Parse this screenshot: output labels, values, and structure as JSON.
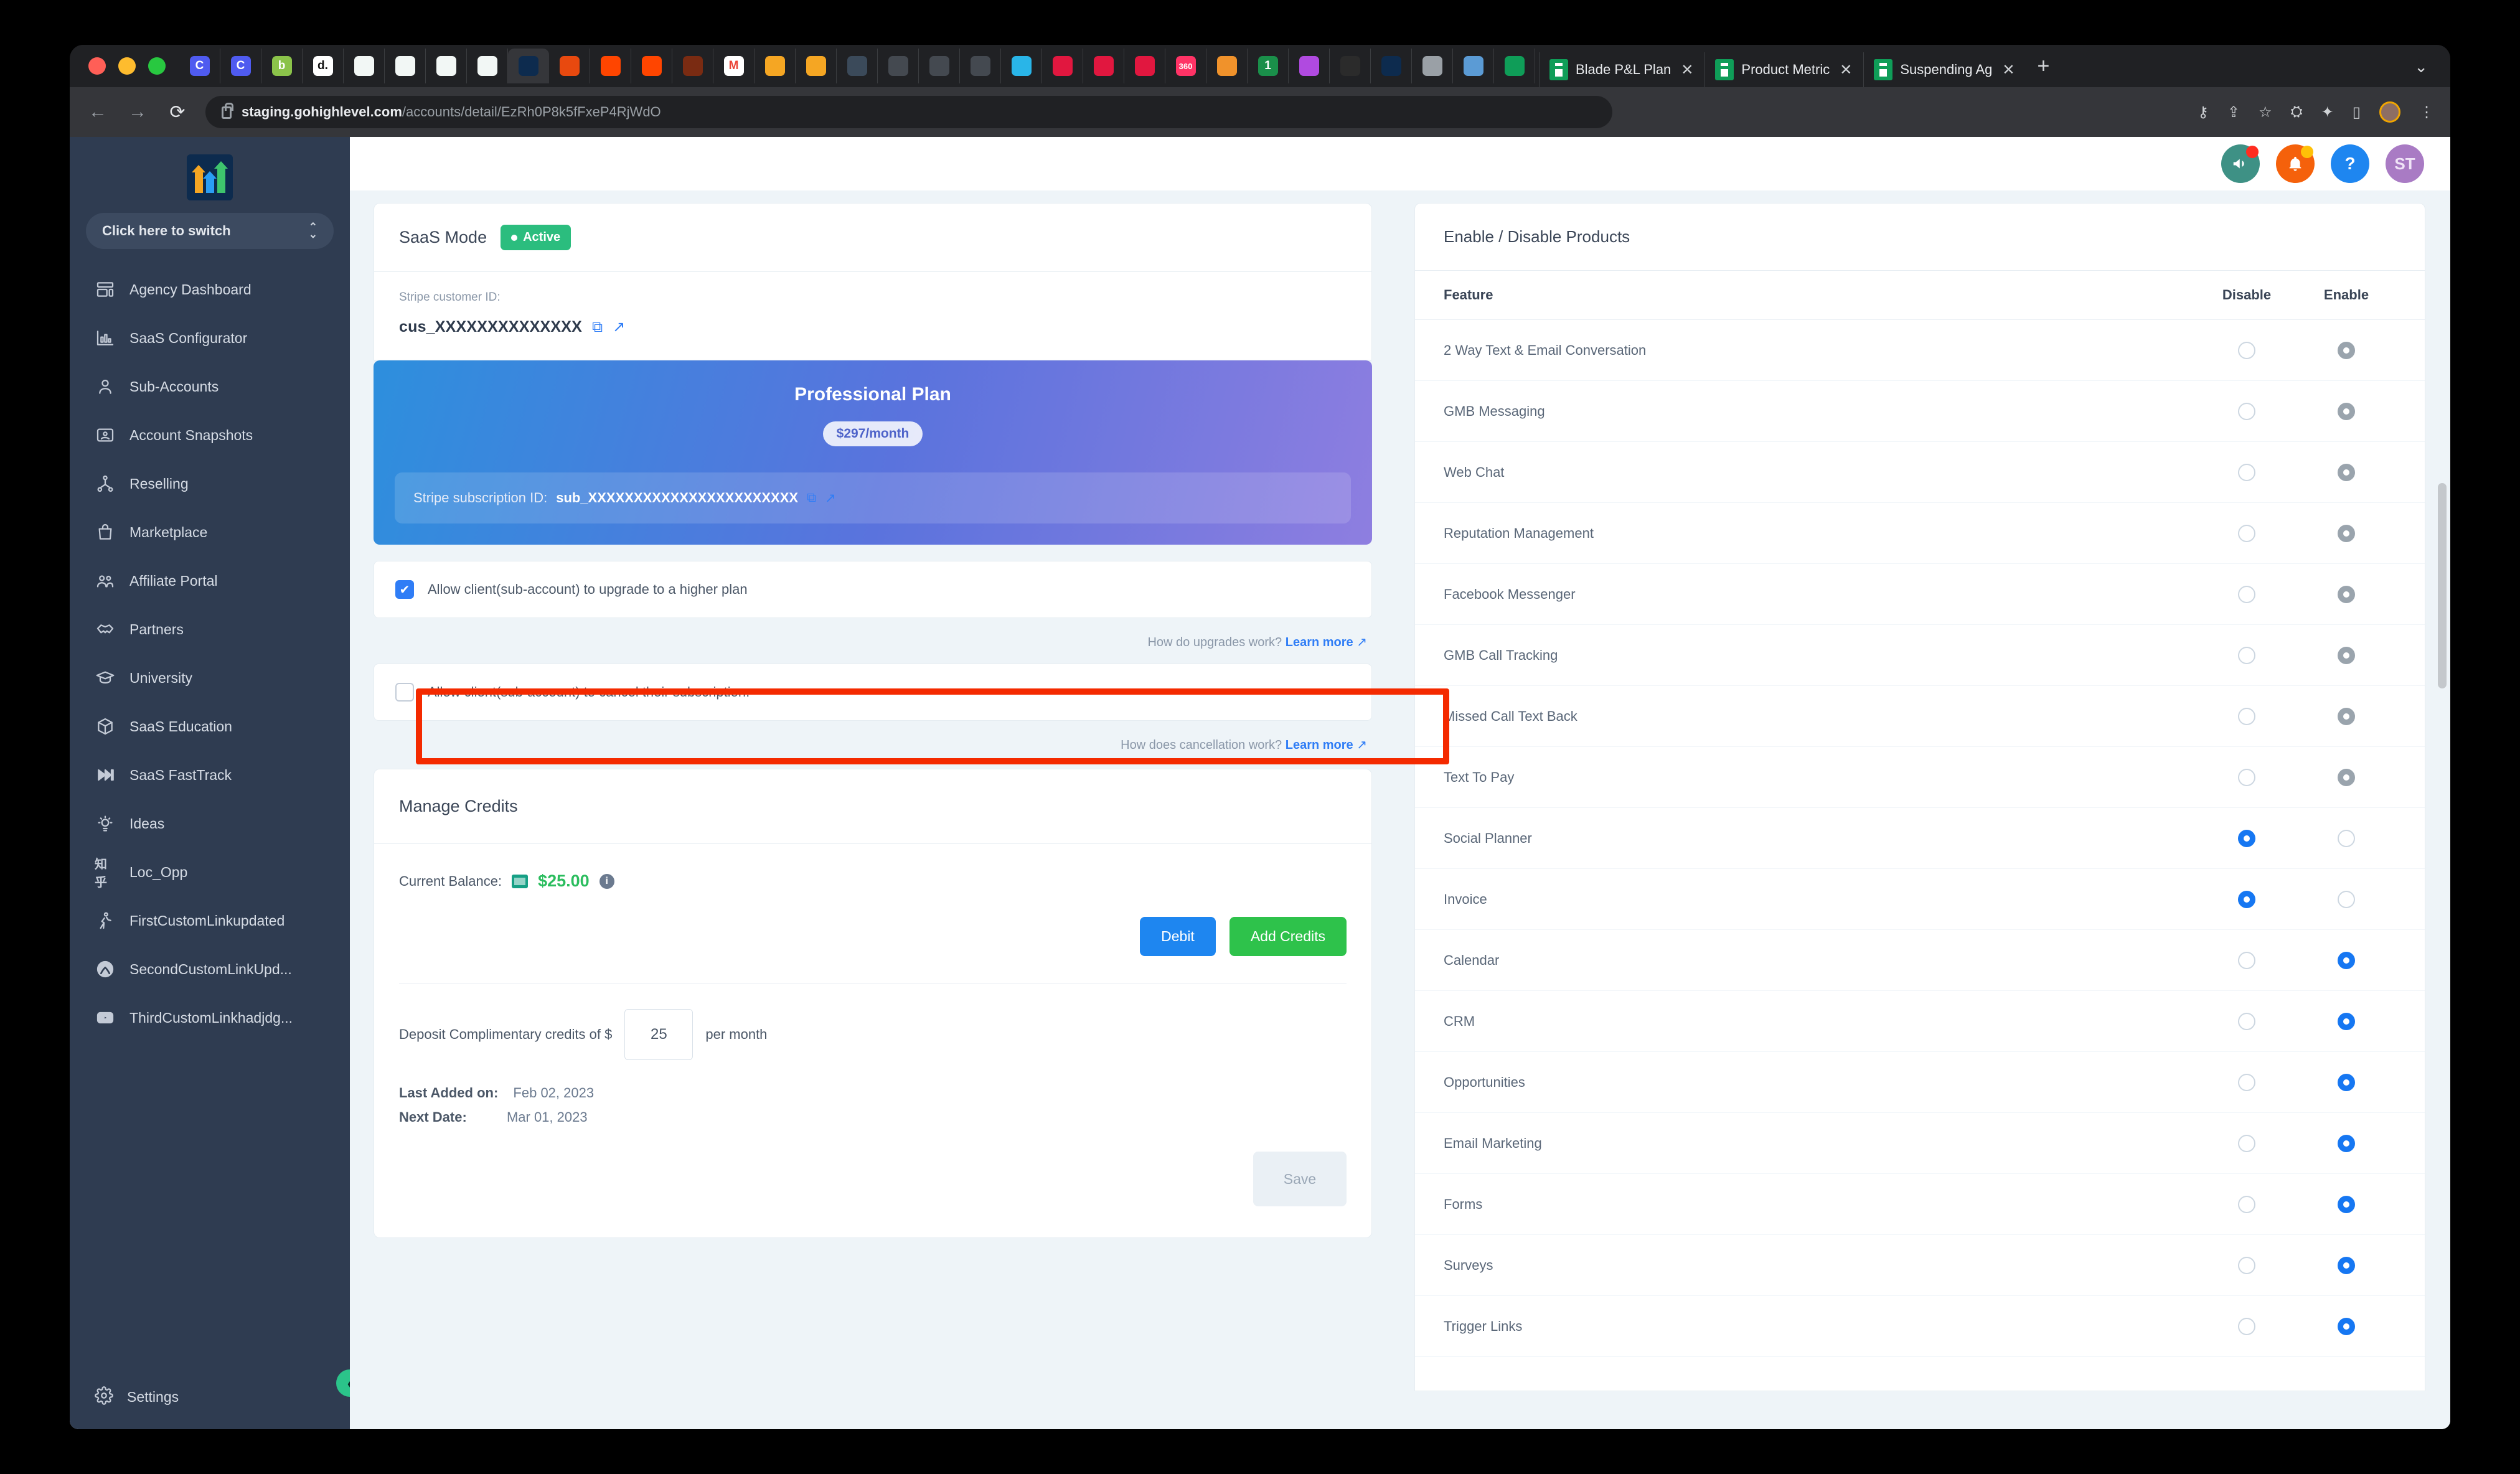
{
  "browser": {
    "traffic_lights": [
      "close",
      "minimize",
      "zoom"
    ],
    "pinned_tabs": [
      {
        "name": "c-tab-1",
        "glyph": "C",
        "bg": "#4f5bf0"
      },
      {
        "name": "c-tab-2",
        "glyph": "C",
        "bg": "#4f5bf0"
      },
      {
        "name": "b-tab",
        "glyph": "b",
        "bg": "#8bc34a"
      },
      {
        "name": "d-tab",
        "glyph": "d.",
        "bg": "#ffffff",
        "fg": "#111111"
      },
      {
        "name": "doc-tab-1",
        "glyph": "",
        "bg": "#f2f7f5"
      },
      {
        "name": "doc-tab-2",
        "glyph": "",
        "bg": "#f2f7f5"
      },
      {
        "name": "doc-tab-3",
        "glyph": "",
        "bg": "#f2f7f5"
      },
      {
        "name": "doc-tab-4",
        "glyph": "",
        "bg": "#f2f7f5"
      },
      {
        "name": "highlevel-tab",
        "glyph": "",
        "bg": "#0d2b4e",
        "active": true
      },
      {
        "name": "swirl-tab",
        "glyph": "",
        "bg": "#e8490f"
      },
      {
        "name": "orange-tab-1",
        "glyph": "",
        "bg": "#ff4500"
      },
      {
        "name": "orange-tab-2",
        "glyph": "",
        "bg": "#ff4500"
      },
      {
        "name": "brown-tab",
        "glyph": "",
        "bg": "#7a2b12"
      },
      {
        "name": "gmail-tab",
        "glyph": "M",
        "bg": "#ffffff",
        "fg": "#ea4335"
      },
      {
        "name": "fire-tab-1",
        "glyph": "",
        "bg": "#f5a623"
      },
      {
        "name": "fire-tab-2",
        "glyph": "",
        "bg": "#f5a623"
      },
      {
        "name": "person-tab",
        "glyph": "",
        "bg": "#3b4a5a"
      },
      {
        "name": "hex-tab-1",
        "glyph": "",
        "bg": "#444950"
      },
      {
        "name": "hex-tab-2",
        "glyph": "",
        "bg": "#444950"
      },
      {
        "name": "hex-tab-3",
        "glyph": "",
        "bg": "#444950"
      },
      {
        "name": "snowflake-tab",
        "glyph": "",
        "bg": "#29b5e8"
      },
      {
        "name": "red-circle-tab-1",
        "glyph": "",
        "bg": "#e1173f"
      },
      {
        "name": "red-circle-tab-2",
        "glyph": "",
        "bg": "#e1173f"
      },
      {
        "name": "target-tab",
        "glyph": "",
        "bg": "#e1173f"
      },
      {
        "name": "360-tab",
        "glyph": "360",
        "bg": "#ff3366"
      },
      {
        "name": "triangle-tab",
        "glyph": "",
        "bg": "#f0922b"
      },
      {
        "name": "one-tab",
        "glyph": "1",
        "bg": "#1a8f4a"
      },
      {
        "name": "wave-tab",
        "glyph": "",
        "bg": "#b04ae0"
      },
      {
        "name": "circle-logo-tab",
        "glyph": "",
        "bg": "#2b2b2b"
      },
      {
        "name": "highlevel-tab-2",
        "glyph": "",
        "bg": "#0d2b4e"
      },
      {
        "name": "apple-tab",
        "glyph": "",
        "bg": "#9aa0a6"
      },
      {
        "name": "chart-tab",
        "glyph": "",
        "bg": "#5b9bd5"
      },
      {
        "name": "drive-tab",
        "glyph": "",
        "bg": "#0f9d58"
      }
    ],
    "tabs": [
      {
        "title": "Blade P&L Plan",
        "icon": "sheets-icon"
      },
      {
        "title": "Product Metric",
        "icon": "sheets-icon"
      },
      {
        "title": "Suspending Ag",
        "icon": "sheets-icon"
      }
    ],
    "new_tab_label": "+",
    "tab_list_chevron": "⌄",
    "nav": {
      "back": "←",
      "forward": "→",
      "reload": "⟳"
    },
    "url_domain": "staging.gohighlevel.com",
    "url_path": "/accounts/detail/EzRh0P8k5fFxeP4RjWdO",
    "toolbar_icons": [
      "password-key-icon",
      "share-icon",
      "bookmark-star-icon",
      "camera-icon",
      "extension-puzzle-icon",
      "sidebar-panel-icon",
      "profile-avatar",
      "kebab-menu-icon"
    ]
  },
  "header": {
    "announce": {
      "name": "megaphone-icon",
      "bg": "#3e9185",
      "dot": "#ff2d20",
      "glyph": "📣"
    },
    "notifications": {
      "name": "bell-icon",
      "bg": "#f5610b",
      "dot": "#ffc107",
      "glyph": "🔔"
    },
    "help": {
      "name": "help-icon",
      "bg": "#1e86f0",
      "glyph": "?"
    },
    "avatar": {
      "name": "user-avatar",
      "bg": "#a97bc4",
      "initials": "ST"
    }
  },
  "sidebar": {
    "switcher_label": "Click here to switch",
    "items": [
      {
        "label": "Agency Dashboard",
        "icon": "dashboard-icon"
      },
      {
        "label": "SaaS Configurator",
        "icon": "bar-chart-icon"
      },
      {
        "label": "Sub-Accounts",
        "icon": "user-icon"
      },
      {
        "label": "Account Snapshots",
        "icon": "snapshot-icon"
      },
      {
        "label": "Reselling",
        "icon": "network-icon"
      },
      {
        "label": "Marketplace",
        "icon": "bag-icon"
      },
      {
        "label": "Affiliate Portal",
        "icon": "people-icon"
      },
      {
        "label": "Partners",
        "icon": "handshake-icon"
      },
      {
        "label": "University",
        "icon": "graduation-cap-icon"
      },
      {
        "label": "SaaS Education",
        "icon": "box-icon"
      },
      {
        "label": "SaaS FastTrack",
        "icon": "fast-forward-icon"
      },
      {
        "label": "Ideas",
        "icon": "lightbulb-icon"
      },
      {
        "label": "Loc_Opp",
        "icon": "zhihu-icon"
      },
      {
        "label": "FirstCustomLinkupdated",
        "icon": "walking-icon"
      },
      {
        "label": "SecondCustomLinkUpd...",
        "icon": "xbox-icon"
      },
      {
        "label": "ThirdCustomLinkhadjdg...",
        "icon": "youtube-icon"
      }
    ],
    "settings_label": "Settings",
    "collapse_icon": "chevron-left-icon"
  },
  "main": {
    "saas_mode_label": "SaaS Mode",
    "saas_mode_status": "Active",
    "stripe_customer_label": "Stripe customer ID:",
    "stripe_customer_id": "cus_XXXXXXXXXXXXXX",
    "plan": {
      "name": "Professional Plan",
      "price": "$297/month",
      "sub_label": "Stripe subscription ID:",
      "sub_id": "sub_XXXXXXXXXXXXXXXXXXXXXXX"
    },
    "upgrade": {
      "checkbox_label": "Allow client(sub-account) to upgrade to a higher plan",
      "checked": true,
      "helper_question": "How do upgrades work?",
      "helper_link": "Learn more"
    },
    "cancel": {
      "checkbox_label": "Allow client(sub-account) to cancel their subscription.",
      "checked": false,
      "helper_question": "How does cancellation work?",
      "helper_link": "Learn more"
    },
    "credits": {
      "title": "Manage Credits",
      "balance_label": "Current Balance:",
      "balance_value": "$25.00",
      "debit_label": "Debit",
      "add_credits_label": "Add Credits",
      "deposit_prefix": "Deposit Complimentary credits of $",
      "deposit_value": "25",
      "deposit_suffix": "per month",
      "last_added_label": "Last Added on:",
      "last_added_value": "Feb 02, 2023",
      "next_date_label": "Next Date:",
      "next_date_value": "Mar 01, 2023",
      "save_label": "Save"
    }
  },
  "products": {
    "title": "Enable / Disable Products",
    "columns": [
      "Feature",
      "Disable",
      "Enable"
    ],
    "rows": [
      {
        "feature": "2 Way Text & Email Conversation",
        "disable": false,
        "enable": true,
        "state": "gray"
      },
      {
        "feature": "GMB Messaging",
        "disable": false,
        "enable": true,
        "state": "gray"
      },
      {
        "feature": "Web Chat",
        "disable": false,
        "enable": true,
        "state": "gray"
      },
      {
        "feature": "Reputation Management",
        "disable": false,
        "enable": true,
        "state": "gray"
      },
      {
        "feature": "Facebook Messenger",
        "disable": false,
        "enable": true,
        "state": "gray"
      },
      {
        "feature": "GMB Call Tracking",
        "disable": false,
        "enable": true,
        "state": "gray"
      },
      {
        "feature": "Missed Call Text Back",
        "disable": false,
        "enable": true,
        "state": "gray"
      },
      {
        "feature": "Text To Pay",
        "disable": false,
        "enable": true,
        "state": "gray"
      },
      {
        "feature": "Social Planner",
        "disable": true,
        "enable": false,
        "state": "blue"
      },
      {
        "feature": "Invoice",
        "disable": true,
        "enable": false,
        "state": "blue"
      },
      {
        "feature": "Calendar",
        "disable": false,
        "enable": true,
        "state": "blue"
      },
      {
        "feature": "CRM",
        "disable": false,
        "enable": true,
        "state": "blue"
      },
      {
        "feature": "Opportunities",
        "disable": false,
        "enable": true,
        "state": "blue"
      },
      {
        "feature": "Email Marketing",
        "disable": false,
        "enable": true,
        "state": "blue"
      },
      {
        "feature": "Forms",
        "disable": false,
        "enable": true,
        "state": "blue"
      },
      {
        "feature": "Surveys",
        "disable": false,
        "enable": true,
        "state": "blue"
      },
      {
        "feature": "Trigger Links",
        "disable": false,
        "enable": true,
        "state": "blue"
      }
    ]
  },
  "colors": {
    "accent_blue": "#1677f2",
    "green": "#2bbd7e",
    "highlight_red": "#f42a00",
    "sidebar_bg": "#2f3c51"
  }
}
